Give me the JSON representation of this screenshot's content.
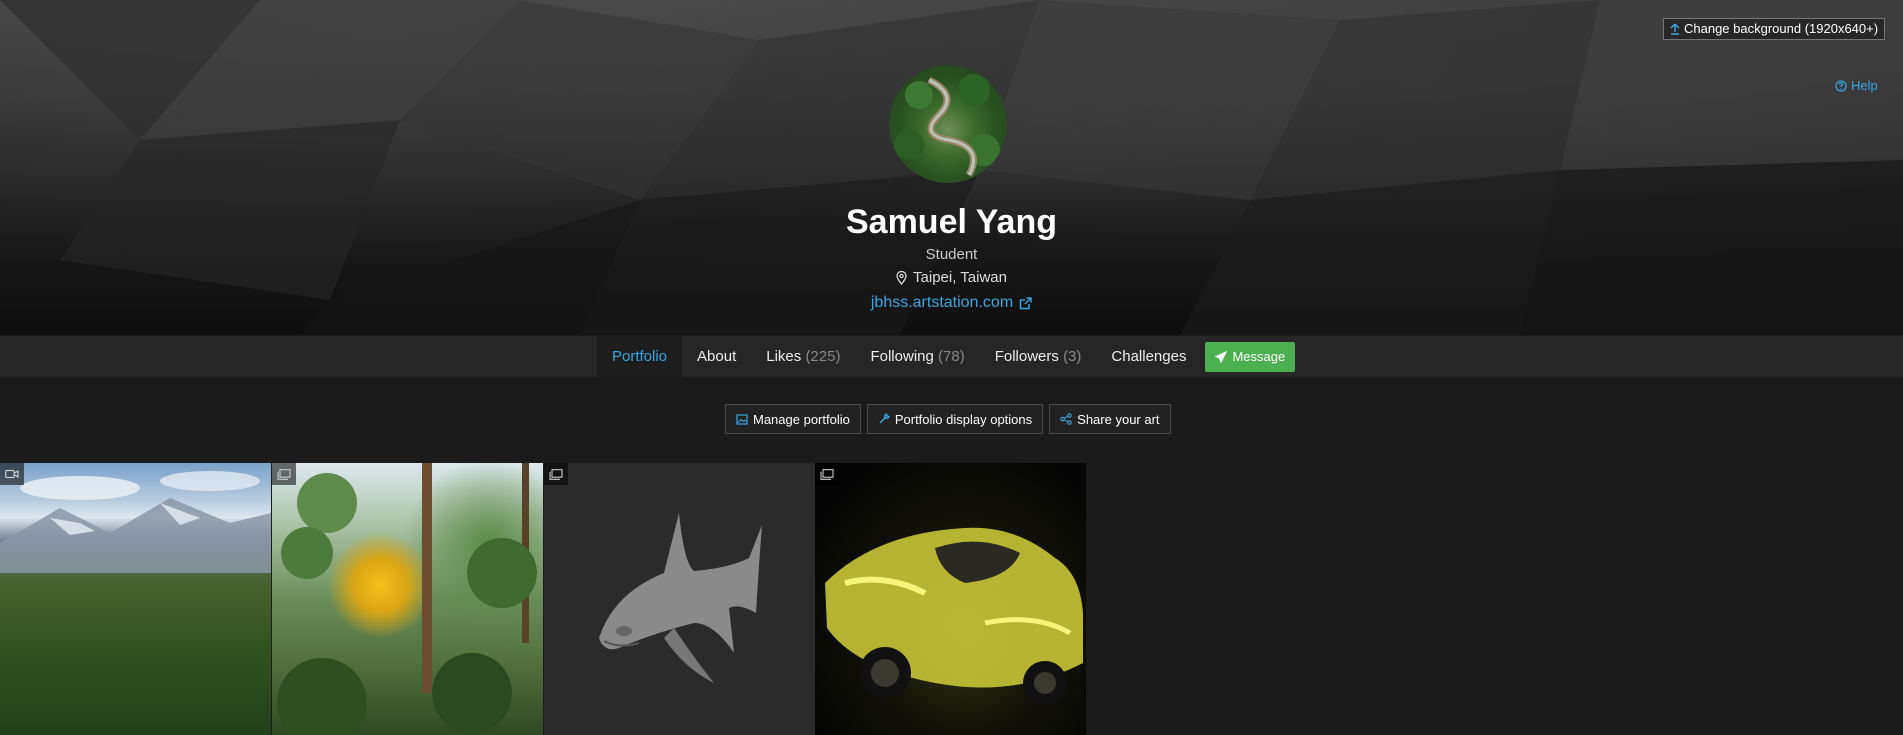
{
  "header": {
    "change_background": "Change background (1920x640+)",
    "help": "Help",
    "profile_name": "Samuel Yang",
    "headline": "Student",
    "location": "Taipei, Taiwan",
    "website": "jbhss.artstation.com"
  },
  "nav": {
    "portfolio": "Portfolio",
    "about": "About",
    "likes": "Likes",
    "likes_count": "(225)",
    "following": "Following",
    "following_count": "(78)",
    "followers": "Followers",
    "followers_count": "(3)",
    "challenges": "Challenges",
    "message": "Message"
  },
  "actions": {
    "manage_portfolio": "Manage portfolio",
    "display_options": "Portfolio display options",
    "share_art": "Share your art"
  },
  "gallery": [
    {
      "badge_icon": "video-icon",
      "subject": "mountain-landscape"
    },
    {
      "badge_icon": "images-icon",
      "subject": "forest-autumn-tree"
    },
    {
      "badge_icon": "images-icon",
      "subject": "shark-sculpt"
    },
    {
      "badge_icon": "images-icon",
      "subject": "yellow-sports-car"
    }
  ],
  "colors": {
    "accent_blue": "#3ba5e0",
    "message_green": "#4caf50",
    "page_background": "#1b1b1b",
    "nav_background": "#262626"
  }
}
